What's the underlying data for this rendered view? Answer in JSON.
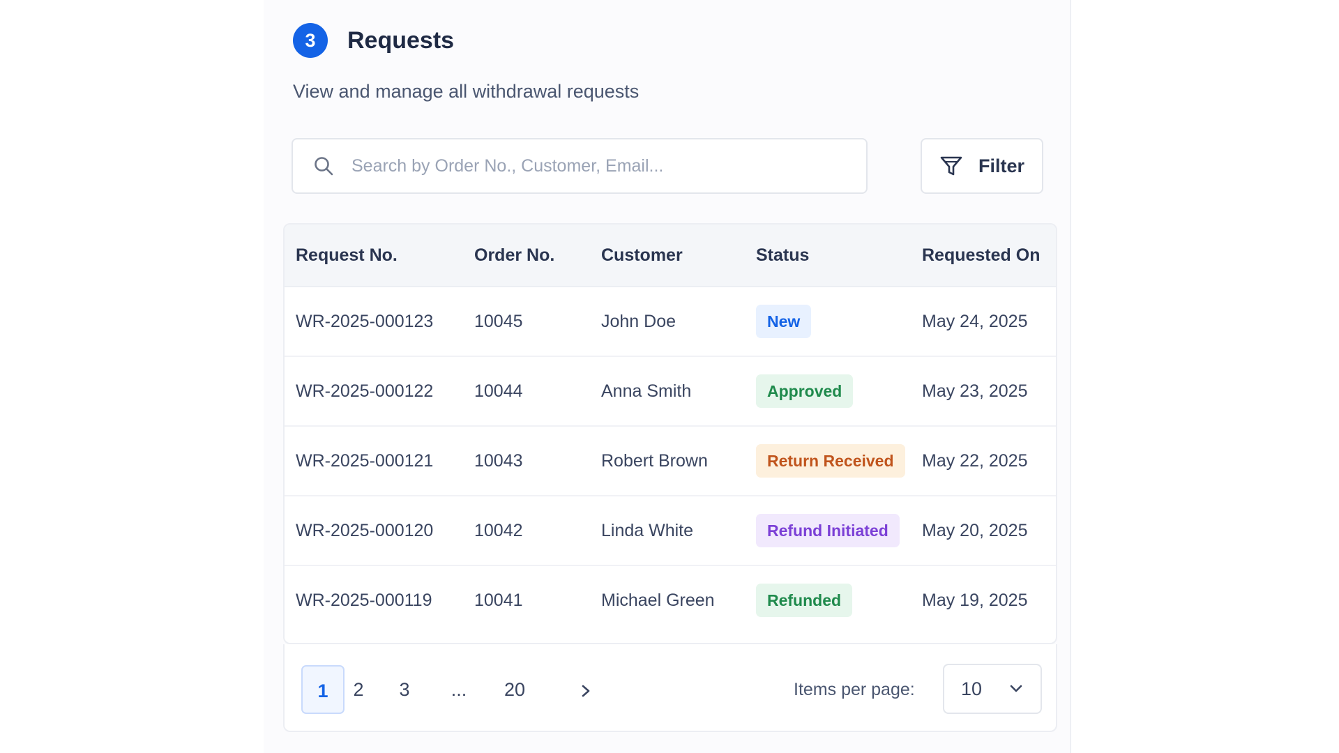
{
  "header": {
    "step": "3",
    "title": "Requests",
    "subtitle": "View and manage all withdrawal requests"
  },
  "search": {
    "placeholder": "Search by Order No., Customer, Email...",
    "icon": "search-icon"
  },
  "filter": {
    "label": "Filter",
    "icon": "filter-icon"
  },
  "table": {
    "columns": [
      "Request No.",
      "Order No.",
      "Customer",
      "Status",
      "Requested On"
    ],
    "rows": [
      {
        "request_no": "WR-2025-000123",
        "order_no": "10045",
        "customer": "John Doe",
        "status": "New",
        "requested_on": "May 24, 2025",
        "status_bg": "#e8f1ff",
        "status_fg": "#1463e6"
      },
      {
        "request_no": "WR-2025-000122",
        "order_no": "10044",
        "customer": "Anna Smith",
        "status": "Approved",
        "requested_on": "May 23, 2025",
        "status_bg": "#e6f6ec",
        "status_fg": "#1f8a4c"
      },
      {
        "request_no": "WR-2025-000121",
        "order_no": "10043",
        "customer": "Robert Brown",
        "status": "Return Received",
        "requested_on": "May 22, 2025",
        "status_bg": "#fdf0dd",
        "status_fg": "#c0541c"
      },
      {
        "request_no": "WR-2025-000120",
        "order_no": "10042",
        "customer": "Linda White",
        "status": "Refund Initiated",
        "requested_on": "May 20, 2025",
        "status_bg": "#f1e9fd",
        "status_fg": "#7b3fd6"
      },
      {
        "request_no": "WR-2025-000119",
        "order_no": "10041",
        "customer": "Michael Green",
        "status": "Refunded",
        "requested_on": "May 19, 2025",
        "status_bg": "#e6f6ec",
        "status_fg": "#1f8a4c"
      }
    ]
  },
  "pagination": {
    "pages": [
      "1",
      "2",
      "3",
      "...",
      "20"
    ],
    "current": "1",
    "next_icon": "chevron-right-icon",
    "items_per_page_label": "Items per page:",
    "items_per_page_value": "10",
    "dropdown_icon": "chevron-down-icon"
  },
  "colors": {
    "accent": "#1463e6"
  }
}
